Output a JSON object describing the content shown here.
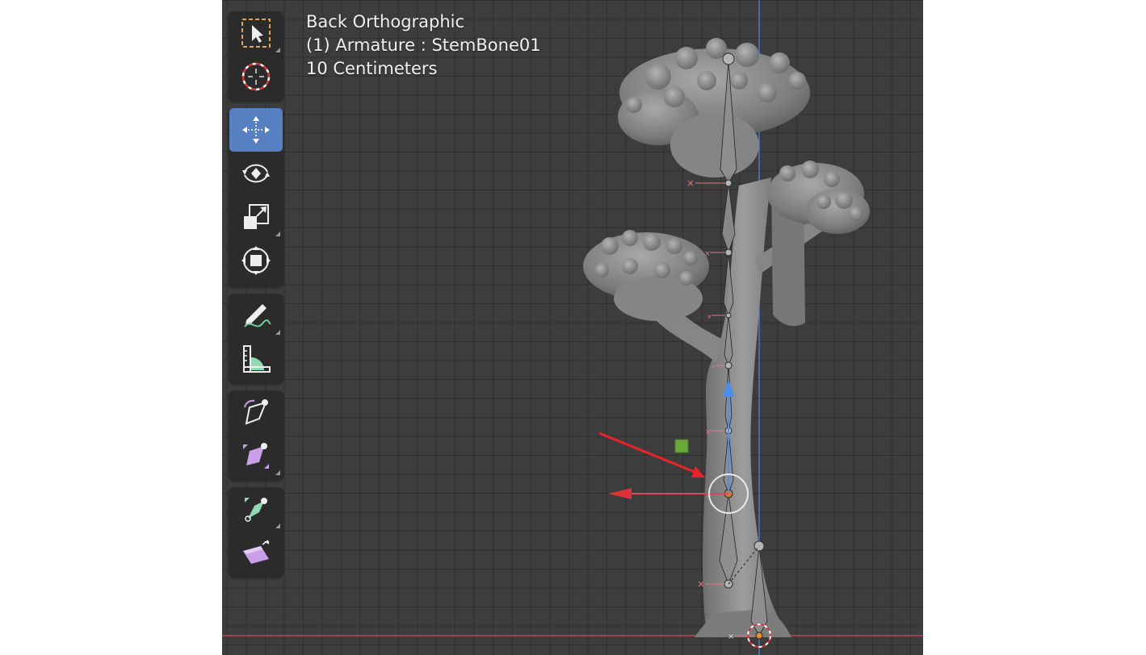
{
  "viewport": {
    "view_name": "Back Orthographic",
    "active_object": "(1) Armature : StemBone01",
    "grid_scale": "10 Centimeters"
  },
  "toolbar": {
    "tools": [
      {
        "name": "select-box",
        "icon": "select-box-icon",
        "active": false
      },
      {
        "name": "cursor",
        "icon": "cursor-icon",
        "active": false
      },
      {
        "name": "move",
        "icon": "move-icon",
        "active": true
      },
      {
        "name": "rotate",
        "icon": "rotate-icon",
        "active": false
      },
      {
        "name": "scale",
        "icon": "scale-icon",
        "active": false
      },
      {
        "name": "transform",
        "icon": "transform-icon",
        "active": false
      },
      {
        "name": "annotate",
        "icon": "annotate-icon",
        "active": false
      },
      {
        "name": "measure",
        "icon": "measure-icon",
        "active": false
      },
      {
        "name": "roll",
        "icon": "bone-roll-icon",
        "active": false
      },
      {
        "name": "bone-size",
        "icon": "bone-size-icon",
        "active": false
      },
      {
        "name": "bone-envelope",
        "icon": "bone-envelope-icon",
        "active": false
      },
      {
        "name": "extrude",
        "icon": "extrude-icon",
        "active": false
      }
    ]
  },
  "colors": {
    "viewport_bg": "#3d3d3d",
    "active_tool": "#5680c2",
    "x_axis": "#d94a59",
    "z_axis": "#4a8ef0",
    "annotation_arrow": "#e8232a",
    "mesh": "#8a8a8a"
  }
}
